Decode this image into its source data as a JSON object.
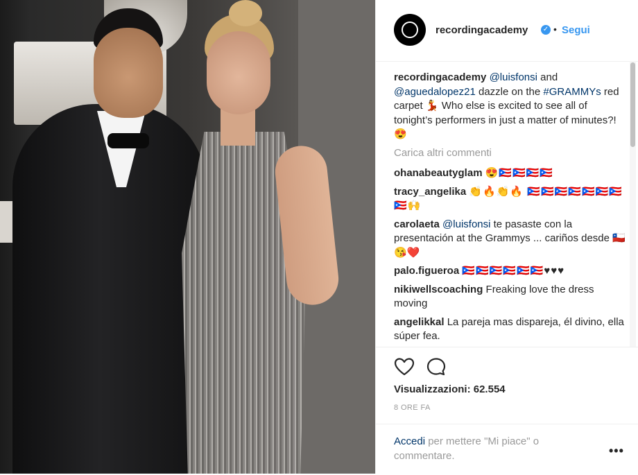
{
  "post": {
    "username": "recordingacademy",
    "follow_label": "Segui",
    "separator": "•",
    "verified_icon": "verified-badge-icon"
  },
  "caption": {
    "username": "recordingacademy",
    "mention1": "@luisfonsi",
    "text1": " and ",
    "mention2": "@aguedalopez21",
    "text2": " dazzle on the ",
    "hashtag": "#GRAMMYs",
    "text3": " red carpet 💃 Who else is excited to see all of tonight’s performers in just a matter of minutes?! 😍"
  },
  "load_more": "Carica altri commenti",
  "comments": [
    {
      "user": "ohanabeautyglam",
      "text": "😍🇵🇷🇵🇷🇵🇷🇵🇷"
    },
    {
      "user": "tracy_angelika",
      "text": "👏🔥👏🔥 🇵🇷🇵🇷🇵🇷🇵🇷🇵🇷🇵🇷🇵🇷🇵🇷🙌"
    },
    {
      "user": "carolaeta",
      "mention": "@luisfonsi",
      "text": " te pasaste con la presentación at the Grammys ... cariños desde 🇨🇱😘❤️"
    },
    {
      "user": "palo.figueroa",
      "text": "🇵🇷🇵🇷🇵🇷🇵🇷🇵🇷🇵🇷♥♥♥"
    },
    {
      "user": "nikiwellscoaching",
      "text": "Freaking love the dress moving"
    },
    {
      "user": "angelikkal",
      "text": "La pareja mas dispareja, él divino, ella súper fea."
    }
  ],
  "actions": {
    "like_icon": "heart-icon",
    "comment_icon": "comment-icon",
    "views": "Visualizzazioni: 62.554",
    "time": "8 ORE FA"
  },
  "login": {
    "link": "Accedi",
    "text": " per mettere \"Mi piace\" o commentare.",
    "more": "•••"
  },
  "colors": {
    "link": "#003569",
    "follow": "#3897f0",
    "muted": "#999999"
  }
}
